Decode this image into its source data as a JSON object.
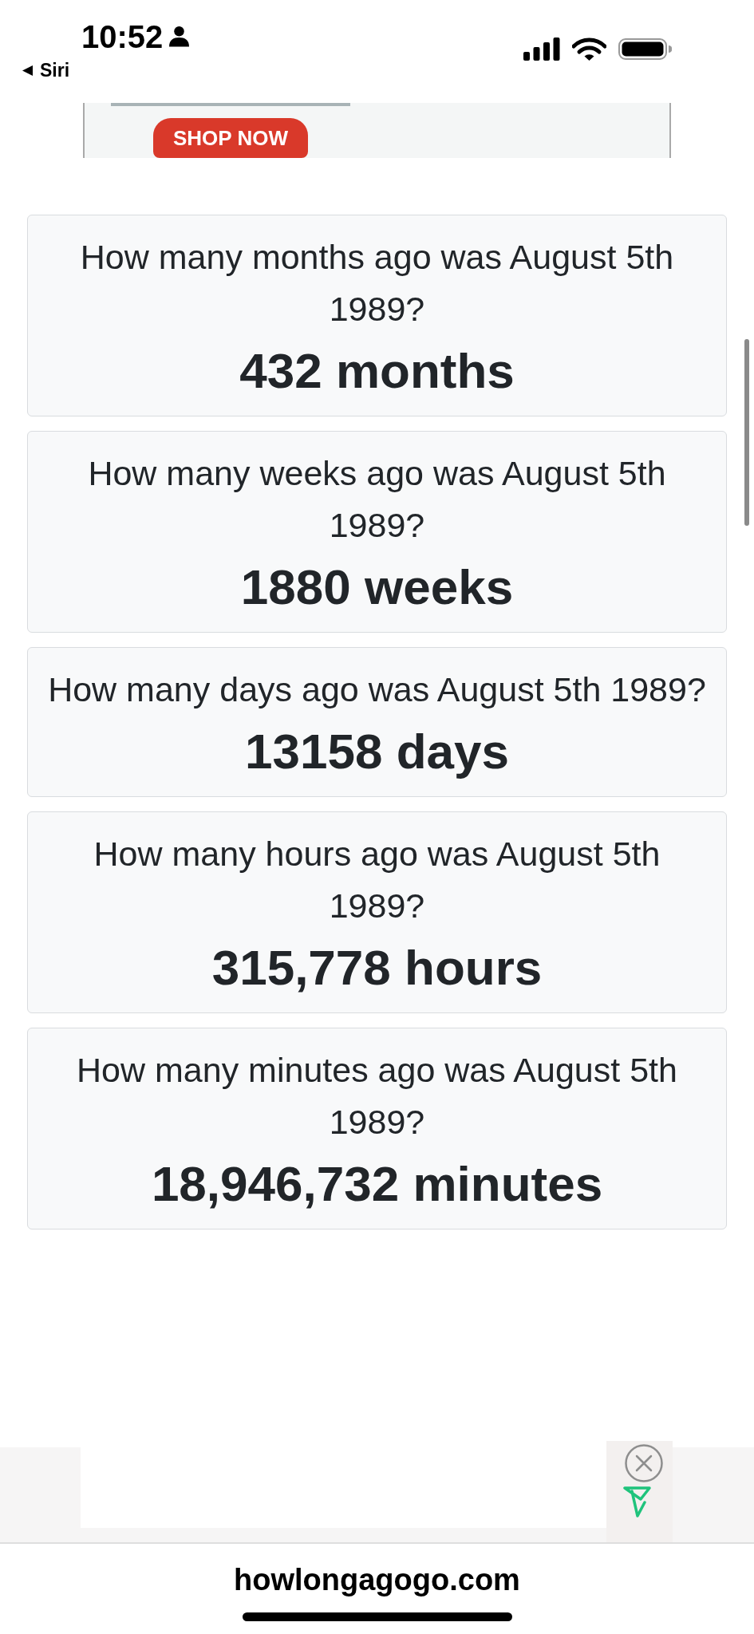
{
  "status_bar": {
    "time": "10:52",
    "back_link": "Siri"
  },
  "ad_banner": {
    "button": "SHOP NOW"
  },
  "cards": [
    {
      "question": "How many months ago was August 5th 1989?",
      "answer": "432 months"
    },
    {
      "question": "How many weeks ago was August 5th 1989?",
      "answer": "1880 weeks"
    },
    {
      "question": "How many days ago was August 5th 1989?",
      "answer": "13158 days"
    },
    {
      "question": "How many hours ago was August 5th 1989?",
      "answer": "315,778 hours"
    },
    {
      "question": "How many minutes ago was August 5th 1989?",
      "answer": "18,946,732 minutes"
    }
  ],
  "address_bar": {
    "url": "howlongagogo.com"
  }
}
